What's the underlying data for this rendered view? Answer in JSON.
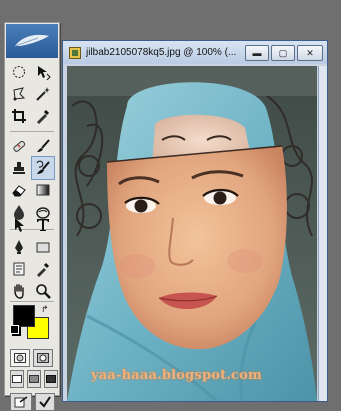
{
  "window": {
    "title": "jilbab2105078kq5.jpg @ 100% (...",
    "buttons": {
      "minimize": "▬",
      "maximize": "▢",
      "close": "✕"
    }
  },
  "toolbox": {
    "header_icon": "feather-icon",
    "tools": [
      {
        "name": "marquee-icon"
      },
      {
        "name": "move-icon"
      },
      {
        "name": "lasso-icon"
      },
      {
        "name": "magic-wand-icon"
      },
      {
        "name": "crop-icon"
      },
      {
        "name": "eyedropper-icon"
      },
      {
        "name": "healing-brush-icon"
      },
      {
        "name": "brush-icon"
      },
      {
        "name": "stamp-icon"
      },
      {
        "name": "history-brush-icon"
      },
      {
        "name": "eraser-icon"
      },
      {
        "name": "gradient-icon"
      },
      {
        "name": "blur-icon"
      },
      {
        "name": "dodge-icon"
      },
      {
        "name": "path-select-icon"
      },
      {
        "name": "type-icon"
      },
      {
        "name": "pen-icon"
      },
      {
        "name": "shape-icon"
      },
      {
        "name": "notes-icon"
      },
      {
        "name": "eyedropper-2-icon"
      },
      {
        "name": "hand-icon"
      },
      {
        "name": "zoom-icon"
      }
    ],
    "foreground_color": "#000000",
    "background_color": "#ffff00"
  },
  "watermark": {
    "text": "yaa-haaa.blogspot.com"
  },
  "colors": {
    "titlebar": "#c9d7ea",
    "accent": "#3c5d8a"
  }
}
